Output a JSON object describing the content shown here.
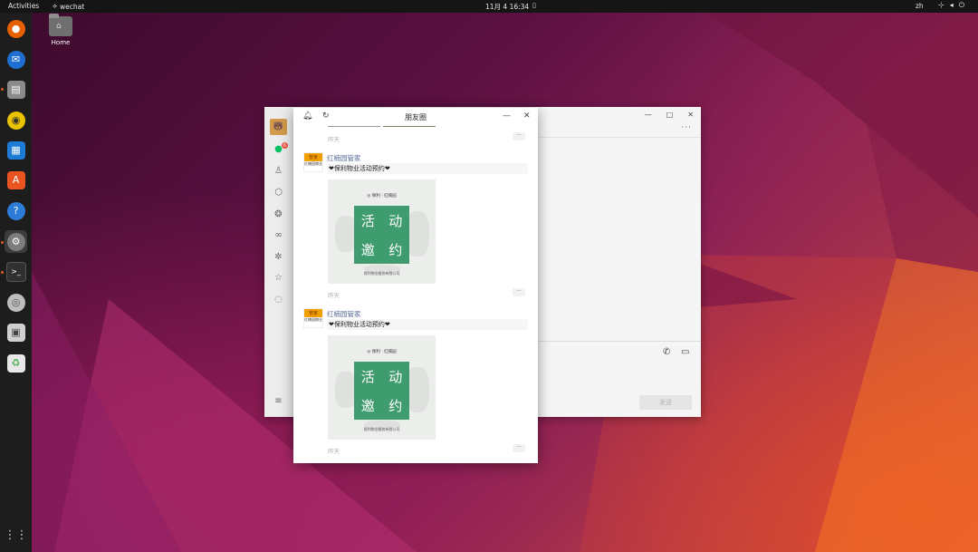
{
  "topbar": {
    "activities": "Activities",
    "app_name": "wechat",
    "clock": "11月 4  16:34",
    "language": "zh"
  },
  "desktop": {
    "home_label": "Home"
  },
  "dock": {
    "items": [
      {
        "name": "firefox",
        "icon": "firefox-icon",
        "color": "#e66000"
      },
      {
        "name": "thunderbird",
        "icon": "thunderbird-icon",
        "color": "#1f6fd1"
      },
      {
        "name": "files",
        "icon": "files-icon",
        "color": "#8b8b8b"
      },
      {
        "name": "rhythmbox",
        "icon": "rhythmbox-icon",
        "color": "#e9c200"
      },
      {
        "name": "writer",
        "icon": "writer-icon",
        "color": "#1e7bd6"
      },
      {
        "name": "software",
        "icon": "app-store-icon",
        "color": "#e95420"
      },
      {
        "name": "help",
        "icon": "help-icon",
        "color": "#2c7bd6"
      },
      {
        "name": "settings",
        "icon": "settings-icon",
        "color": "#7d7d7d"
      },
      {
        "name": "terminal",
        "icon": "terminal-icon",
        "color": "#303030"
      },
      {
        "name": "disc",
        "icon": "disc-icon",
        "color": "#bdbdbd"
      },
      {
        "name": "save",
        "icon": "floppy-icon",
        "color": "#d0d0d0"
      },
      {
        "name": "trash",
        "icon": "trash-icon",
        "color": "#4caf50"
      }
    ]
  },
  "wechat": {
    "badge_count": "6",
    "send_label": "发送"
  },
  "moments": {
    "title": "朋友圈",
    "first_time": "昨天",
    "posts": [
      {
        "author": "红楠园管家",
        "avatar_top": "管家",
        "avatar_bottom": "红楠园物业",
        "text": "❤保利物业活动预约❤",
        "image_header": "◎ 保利 · 红楠园",
        "image_chars": [
          "活",
          "动",
          "邀",
          "约"
        ],
        "image_footer": "保利物业服务有限公司",
        "time": "昨天"
      },
      {
        "author": "红楠园管家",
        "avatar_top": "管家",
        "avatar_bottom": "红楠园物业",
        "text": "❤保利物业活动预约❤",
        "image_header": "◎ 保利 · 红楠园",
        "image_chars": [
          "活",
          "动",
          "邀",
          "约"
        ],
        "image_footer": "保利物业服务有限公司",
        "time": "昨天"
      }
    ]
  }
}
